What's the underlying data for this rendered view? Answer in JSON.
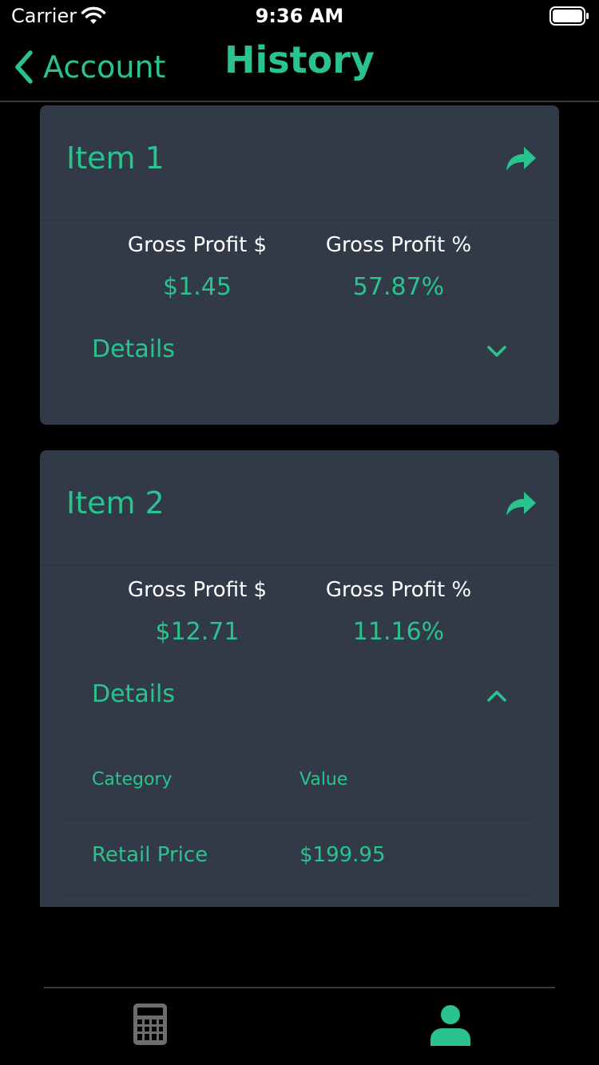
{
  "status_bar": {
    "carrier": "Carrier",
    "time": "9:36 AM",
    "wifi_icon": "wifi-icon",
    "battery_icon": "battery-icon"
  },
  "nav": {
    "back_label": "Account",
    "title": "History"
  },
  "colors": {
    "accent": "#2ac38e",
    "card_bg": "#323a47",
    "background": "#000000",
    "icon_gray": "#6d6d6d"
  },
  "items": [
    {
      "title": "Item 1",
      "gross_profit_dollar_label": "Gross Profit $",
      "gross_profit_dollar": "$1.45",
      "gross_profit_pct_label": "Gross Profit %",
      "gross_profit_pct": "57.87%",
      "details_label": "Details",
      "expanded": false
    },
    {
      "title": "Item 2",
      "gross_profit_dollar_label": "Gross Profit $",
      "gross_profit_dollar": "$12.71",
      "gross_profit_pct_label": "Gross Profit %",
      "gross_profit_pct": "11.16%",
      "details_label": "Details",
      "expanded": true,
      "details_table": {
        "headers": [
          "Category",
          "Value"
        ],
        "rows": [
          [
            "Retail Price",
            "$199.95"
          ]
        ]
      }
    }
  ],
  "tab_bar": {
    "tabs": [
      {
        "icon": "calculator-icon",
        "selected": false
      },
      {
        "icon": "profile-icon",
        "selected": true
      }
    ]
  }
}
